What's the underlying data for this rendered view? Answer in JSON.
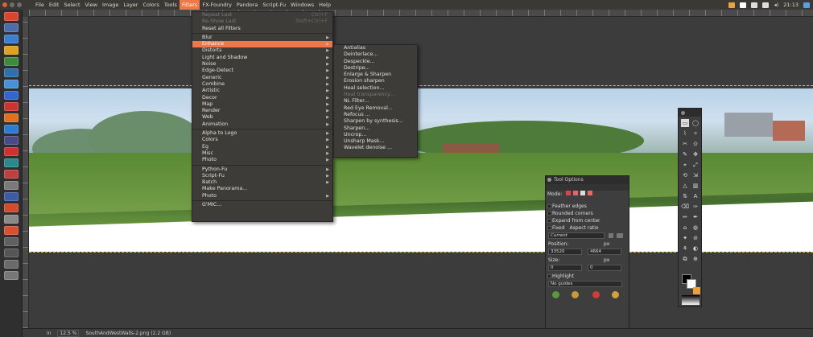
{
  "menubar": {
    "items": [
      "File",
      "Edit",
      "Select",
      "View",
      "Image",
      "Layer",
      "Colors",
      "Tools",
      "Filters",
      "FX-Foundry",
      "Pandora",
      "Script-Fu",
      "Windows",
      "Help"
    ],
    "active_index": 8,
    "clock": "21:13",
    "tray_colors": [
      "#e8a33a",
      "#ffffff",
      "#dddddd",
      "#dddddd",
      "#5aa0e0"
    ]
  },
  "launcher": {
    "icon_colors": [
      "#d9442c",
      "#4a6ea8",
      "#3a7fd0",
      "#e0a020",
      "#3c8b3c",
      "#2f6fb0",
      "#4a90d9",
      "#3366cc",
      "#cc3333",
      "#e07020",
      "#2e7bd0",
      "#4a4a8a",
      "#d03030",
      "#2a8a8a",
      "#c04040",
      "#7a7a7a",
      "#3c5ca8",
      "#d44a2c",
      "#8a8a8a",
      "#d85030",
      "#606060",
      "#555555",
      "#6a6a6a",
      "#777777"
    ]
  },
  "filters_menu": {
    "items": [
      {
        "label": "Repeat Last",
        "shortcut": "Ctrl+F",
        "dim": true
      },
      {
        "label": "Re-Show Last",
        "shortcut": "Shift+Ctrl+F",
        "dim": true
      },
      {
        "label": "Reset all Filters",
        "dim": false
      },
      {
        "sep": true
      },
      {
        "label": "Blur",
        "sub": true
      },
      {
        "label": "Enhance",
        "sub": true,
        "highlight": true
      },
      {
        "label": "Distorts",
        "sub": true
      },
      {
        "label": "Light and Shadow",
        "sub": true
      },
      {
        "label": "Noise",
        "sub": true
      },
      {
        "label": "Edge-Detect",
        "sub": true
      },
      {
        "label": "Generic",
        "sub": true
      },
      {
        "label": "Combine",
        "sub": true
      },
      {
        "label": "Artistic",
        "sub": true
      },
      {
        "label": "Decor",
        "sub": true
      },
      {
        "label": "Map",
        "sub": true
      },
      {
        "label": "Render",
        "sub": true
      },
      {
        "label": "Web",
        "sub": true
      },
      {
        "label": "Animation",
        "sub": true
      },
      {
        "sep": true
      },
      {
        "label": "Alpha to Logo",
        "sub": true
      },
      {
        "label": "Colors",
        "sub": true
      },
      {
        "label": "Eg",
        "sub": true
      },
      {
        "label": "Misc",
        "sub": true
      },
      {
        "label": "Photo",
        "sub": true
      },
      {
        "sep": true
      },
      {
        "label": "Python-Fu",
        "sub": true
      },
      {
        "label": "Script-Fu",
        "sub": true
      },
      {
        "label": "Batch",
        "sub": true
      },
      {
        "label": "Make Panorama...",
        "sub": false
      },
      {
        "label": "Photo",
        "sub": true
      },
      {
        "sep": true
      },
      {
        "label": "G'MIC...",
        "sub": false
      }
    ]
  },
  "enhance_menu": {
    "items": [
      {
        "label": "Antialias"
      },
      {
        "label": "Deinterlace..."
      },
      {
        "label": "Despeckle..."
      },
      {
        "label": "Destripe..."
      },
      {
        "label": "Enlarge & Sharpen"
      },
      {
        "label": "Erosion sharpen"
      },
      {
        "label": "Heal selection..."
      },
      {
        "label": "Heal transparency...",
        "dim": true
      },
      {
        "label": "NL Filter..."
      },
      {
        "label": "Red Eye Removal..."
      },
      {
        "label": "Refocus ..."
      },
      {
        "label": "Sharpen by synthesis..."
      },
      {
        "label": "Sharpen..."
      },
      {
        "label": "Uncrop..."
      },
      {
        "label": "Unsharp Mask..."
      },
      {
        "label": "Wavelet denoise ..."
      }
    ]
  },
  "tool_options": {
    "title": "Tool Options",
    "mode_label": "Mode:",
    "checks": [
      "Feather edges",
      "Rounded corners",
      "Expand from center"
    ],
    "fixed_label": "Fixed",
    "fixed_value": "Aspect ratio",
    "current_value": "Current",
    "position_label": "Position:",
    "position_unit": "px",
    "pos_x": "33520",
    "pos_y": "4664",
    "size_label": "Size:",
    "size_unit": "px",
    "size_w": "0",
    "size_h": "0",
    "highlight_label": "Highlight",
    "guides_value": "No guides"
  },
  "statusbar": {
    "unit": "in",
    "zoom": "12.5 %",
    "filename": "SouthAndWestWalls-2.png (2.2 GB)"
  },
  "toolbox": {
    "tool_glyphs": [
      "▭",
      "◯",
      "⌇",
      "✧",
      "✂",
      "⊙",
      "✎",
      "✥",
      "⌖",
      "⤢",
      "⟲",
      "⇲",
      "△",
      "▥",
      "⇅",
      "A",
      "⌫",
      "✑",
      "✏",
      "✒",
      "⌂",
      "◍",
      "✦",
      "⊘",
      "⚘",
      "◐",
      "⧉",
      "⊕"
    ]
  },
  "colors": {
    "accent": "#f07746",
    "menu_bg": "#3d3c38",
    "fg_color": "#000000",
    "bg_color": "#ffffff",
    "tool_swatch": "#f0a030"
  }
}
